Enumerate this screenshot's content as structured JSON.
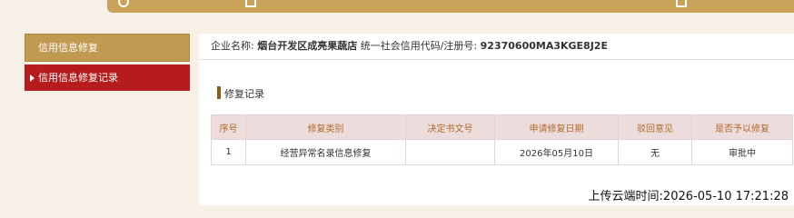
{
  "topbar": {
    "icons": [
      "circle-icon",
      "doc-icon",
      "doc-icon"
    ]
  },
  "sidebar": {
    "header": "信用信息修复",
    "active_item": "信用信息修复记录"
  },
  "company": {
    "name_label": "企业名称:",
    "name": "烟台开发区成亮果蔬店",
    "code_label": "统一社会信用代码/注册号:",
    "code": "92370600MA3KGE8J2E"
  },
  "section_title": "修复记录",
  "table": {
    "headers": [
      "序号",
      "修复类别",
      "决定书文号",
      "申请修复日期",
      "驳回意见",
      "是否予以修复"
    ],
    "rows": [
      [
        "1",
        "经营异常名录信息修复",
        "",
        "2026年05月10日",
        "无",
        "审批中"
      ]
    ]
  },
  "upload_time": "上传云端时间:2026-05-10 17:21:28",
  "colors": {
    "accent_gold": "#c09a50",
    "active_red": "#b71c1c",
    "header_bg": "#ecdcdc",
    "header_text": "#b06a2a"
  }
}
